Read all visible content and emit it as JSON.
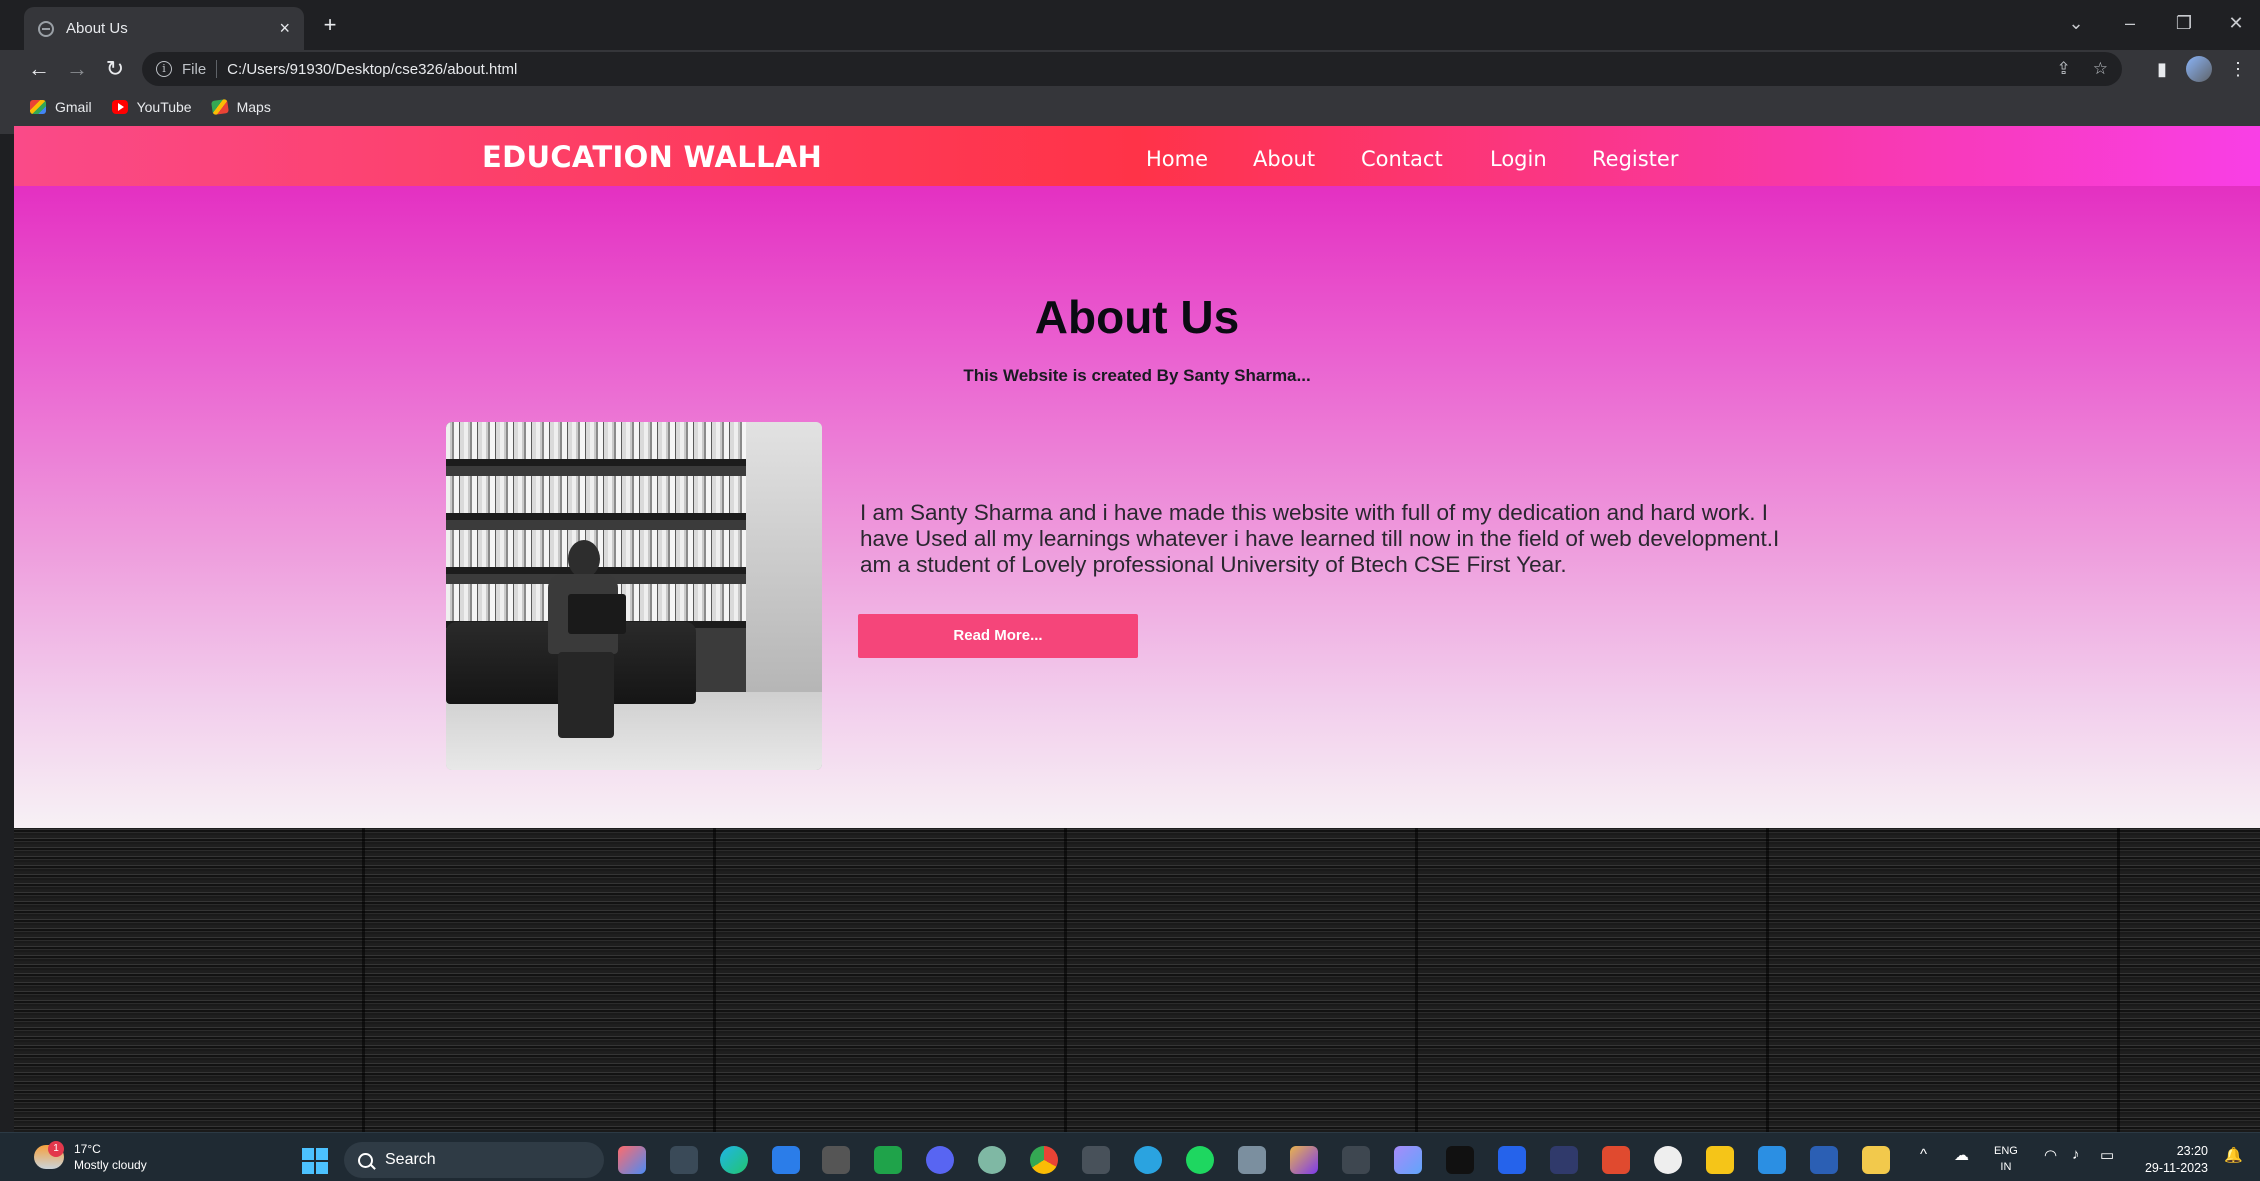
{
  "browser": {
    "tab_title": "About Us",
    "tab_close": "×",
    "new_tab": "+",
    "address_scheme": "File",
    "address_url": "C:/Users/91930/Desktop/cse326/about.html",
    "bookmarks": [
      {
        "label": "Gmail",
        "icon": "gmail-icon"
      },
      {
        "label": "YouTube",
        "icon": "youtube-icon"
      },
      {
        "label": "Maps",
        "icon": "maps-icon"
      }
    ]
  },
  "site": {
    "brand": "EDUCATION WALLAH",
    "nav": [
      "Home",
      "About",
      "Contact",
      "Login",
      "Register"
    ],
    "about": {
      "title": "About Us",
      "subtitle": "This Website is created By Santy Sharma...",
      "body": "I am Santy Sharma and i have made this website with full of my dedication and hard work. I have Used all my learnings whatever i have learned till now in the field of web development.I am a student of Lovely professional University of Btech CSE First Year.",
      "button": "Read More..."
    },
    "colors": {
      "header_start": "#fa4a88",
      "header_end": "#f93fe6",
      "button": "#f5457a"
    }
  },
  "taskbar": {
    "weather_temp": "17°C",
    "weather_desc": "Mostly cloudy",
    "weather_badge": "1",
    "search_label": "Search",
    "lang_top": "ENG",
    "lang_bottom": "IN",
    "time": "23:20",
    "date": "29-11-2023"
  }
}
